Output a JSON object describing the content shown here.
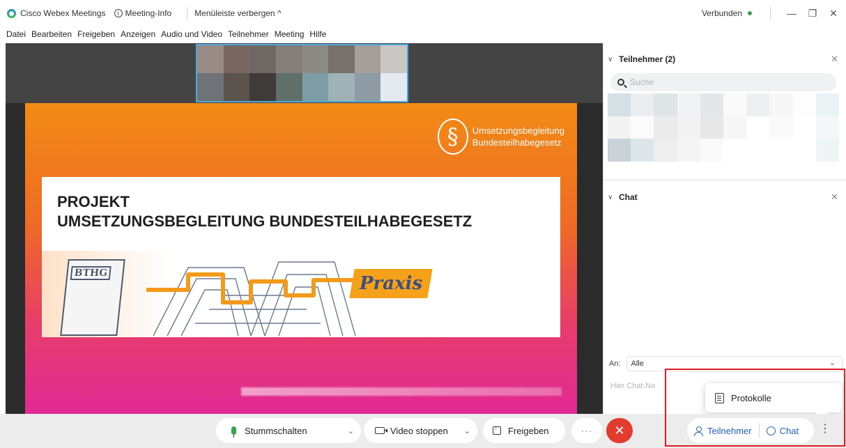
{
  "titlebar": {
    "app_name": "Cisco Webex Meetings",
    "meeting_info": "Meeting-Info",
    "hide_menu": "Menüleiste verbergen ^",
    "status": "Verbunden",
    "status_color": "#2fa84f",
    "min": "—",
    "restore": "❐",
    "close": "✕"
  },
  "menubar": {
    "items": [
      "Datei",
      "Bearbeiten",
      "Freigeben",
      "Anzeigen",
      "Audio und Video",
      "Teilnehmer",
      "Meeting",
      "Hilfe"
    ]
  },
  "slide": {
    "brand_line1": "Umsetzungsbegleitung",
    "brand_line2": "Bundesteilhabegesetz",
    "brand_symbol": "§",
    "title_line1": "PROJEKT",
    "title_line2": "UMSETZUNGSBEGLEITUNG BUNDESTEILHABEGESETZ",
    "book_label": "BTHG",
    "praxis": "Praxis"
  },
  "participants": {
    "title": "Teilnehmer (2)",
    "search_placeholder": "Suche"
  },
  "chat": {
    "title": "Chat",
    "to_label": "An:",
    "to_value": "Alle",
    "input_placeholder": "Hier Chat-Na"
  },
  "popover": {
    "label": "Protokolle"
  },
  "toolbar": {
    "mute": "Stummschalten",
    "video": "Video stoppen",
    "share": "Freigeben",
    "more": "···",
    "end": "✕",
    "participants": "Teilnehmer",
    "chat": "Chat",
    "kebab": "⋮",
    "accent_color": "#2262c6",
    "end_color": "#e23c2e"
  }
}
